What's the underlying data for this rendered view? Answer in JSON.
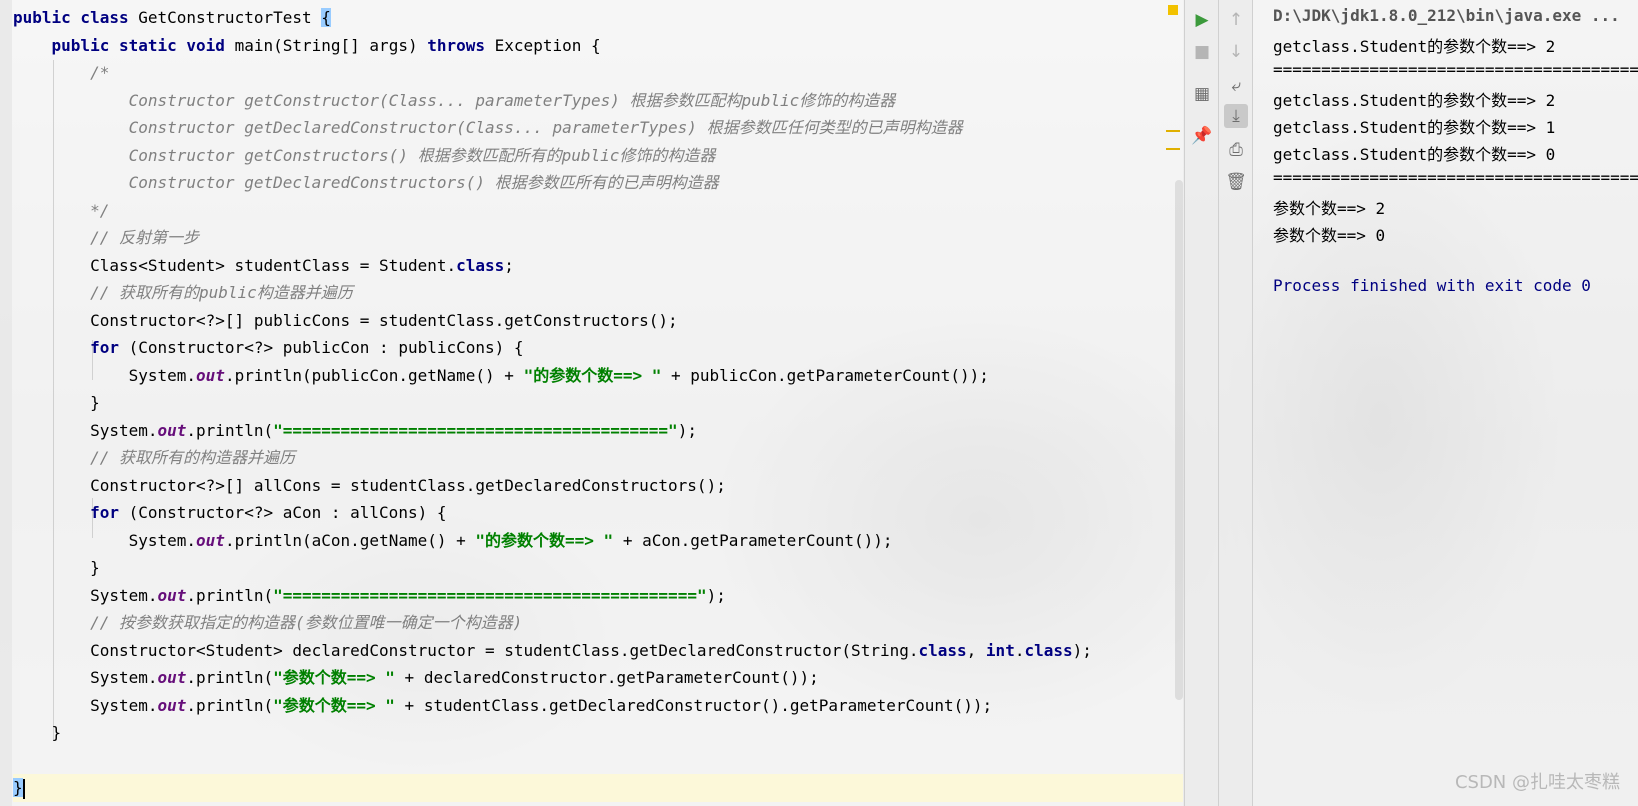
{
  "editor": {
    "lines": [
      [
        "public class GetConstructorTest {"
      ],
      [
        "    public static void main(String[] args) throws Exception {"
      ],
      [
        "        /*"
      ],
      [
        "            Constructor getConstructor(Class... parameterTypes) 根据参数匹配构public修饰的构造器"
      ],
      [
        "            Constructor getDeclaredConstructor(Class... parameterTypes) 根据参数匹任何类型的已声明构造器"
      ],
      [
        "            Constructor getConstructors() 根据参数匹配所有的public修饰的构造器"
      ],
      [
        "            Constructor getDeclaredConstructors() 根据参数匹所有的已声明构造器"
      ],
      [
        "        */"
      ],
      [
        "        // 反射第一步"
      ],
      [
        "        Class<Student> studentClass = Student.class;"
      ],
      [
        "        // 获取所有的public构造器并遍历"
      ],
      [
        "        Constructor<?>[] publicCons = studentClass.getConstructors();"
      ],
      [
        "        for (Constructor<?> publicCon : publicCons) {"
      ],
      [
        "            System.out.println(publicCon.getName() + \"的参数个数==> \" + publicCon.getParameterCount());"
      ],
      [
        "        }"
      ],
      [
        "        System.out.println(\"========================================\");"
      ],
      [
        "        // 获取所有的构造器并遍历"
      ],
      [
        "        Constructor<?>[] allCons = studentClass.getDeclaredConstructors();"
      ],
      [
        "        for (Constructor<?> aCon : allCons) {"
      ],
      [
        "            System.out.println(aCon.getName() + \"的参数个数==> \" + aCon.getParameterCount());"
      ],
      [
        "        }"
      ],
      [
        "        System.out.println(\"===========================================\");"
      ],
      [
        "        // 按参数获取指定的构造器(参数位置唯一确定一个构造器)"
      ],
      [
        "        Constructor<Student> declaredConstructor = studentClass.getDeclaredConstructor(String.class, int.class);"
      ],
      [
        "        System.out.println(\"参数个数==> \" + declaredConstructor.getParameterCount());"
      ],
      [
        "        System.out.println(\"参数个数==> \" + studentClass.getDeclaredConstructor().getParameterCount());"
      ],
      [
        "    }"
      ],
      [
        ""
      ],
      [
        "}"
      ]
    ]
  },
  "toolbar_left": {
    "run": "run-icon",
    "stop": "stop-icon",
    "layout": "layout-icon",
    "pin": "pin-icon"
  },
  "toolbar_right": {
    "up": "arrow-up-icon",
    "down": "arrow-down-icon",
    "wrap": "soft-wrap-icon",
    "scroll_end": "scroll-to-end-icon",
    "print": "print-icon",
    "clear": "trash-icon"
  },
  "console": {
    "command": "D:\\JDK\\jdk1.8.0_212\\bin\\java.exe ...",
    "output": [
      "getclass.Student的参数个数==> 2",
      "========================================",
      "getclass.Student的参数个数==> 2",
      "getclass.Student的参数个数==> 1",
      "getclass.Student的参数个数==> 0",
      "===========================================",
      "参数个数==> 2",
      "参数个数==> 0",
      "",
      "Process finished with exit code 0"
    ]
  },
  "watermark": "CSDN @扎哇太枣糕"
}
